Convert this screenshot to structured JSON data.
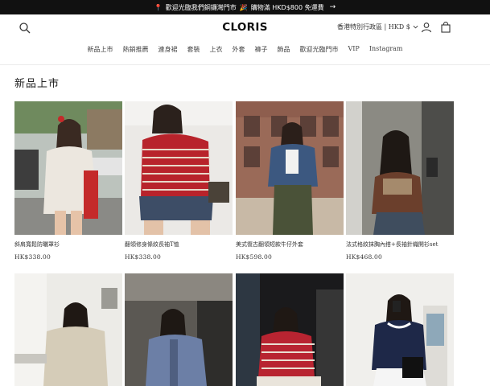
{
  "announcement": {
    "pin_icon": "pin-icon",
    "text": "歡迎光臨我們銅鑼灣門市",
    "party_icon": "party-popper-icon",
    "text2": "購物滿 HKD$800 免運費",
    "arrow": "→"
  },
  "header": {
    "logo": "CLORIS",
    "region": "香港特別行政區 | HKD $",
    "icons": [
      "search-icon",
      "user-icon",
      "bag-icon"
    ]
  },
  "nav": [
    "新品上市",
    "熱銷推薦",
    "連身裙",
    "套裝",
    "上衣",
    "外套",
    "褲子",
    "飾品",
    "歡迎光臨門市",
    "VIP",
    "Instagram"
  ],
  "page": {
    "title": "新品上市"
  },
  "products": [
    {
      "name": "斜肩寬鬆防曬罩衫",
      "price": "HK$338.00"
    },
    {
      "name": "翻領修身條紋長袖T恤",
      "price": "HK$338.00"
    },
    {
      "name": "美式復古翻領短款牛仔外套",
      "price": "HK$598.00"
    },
    {
      "name": "法式格紋抹胸內搭+長袖針織開衫set",
      "price": "HK$468.00"
    }
  ],
  "colors": {
    "announcement_bg": "#111111",
    "text": "#222222",
    "divider": "#ececec"
  }
}
